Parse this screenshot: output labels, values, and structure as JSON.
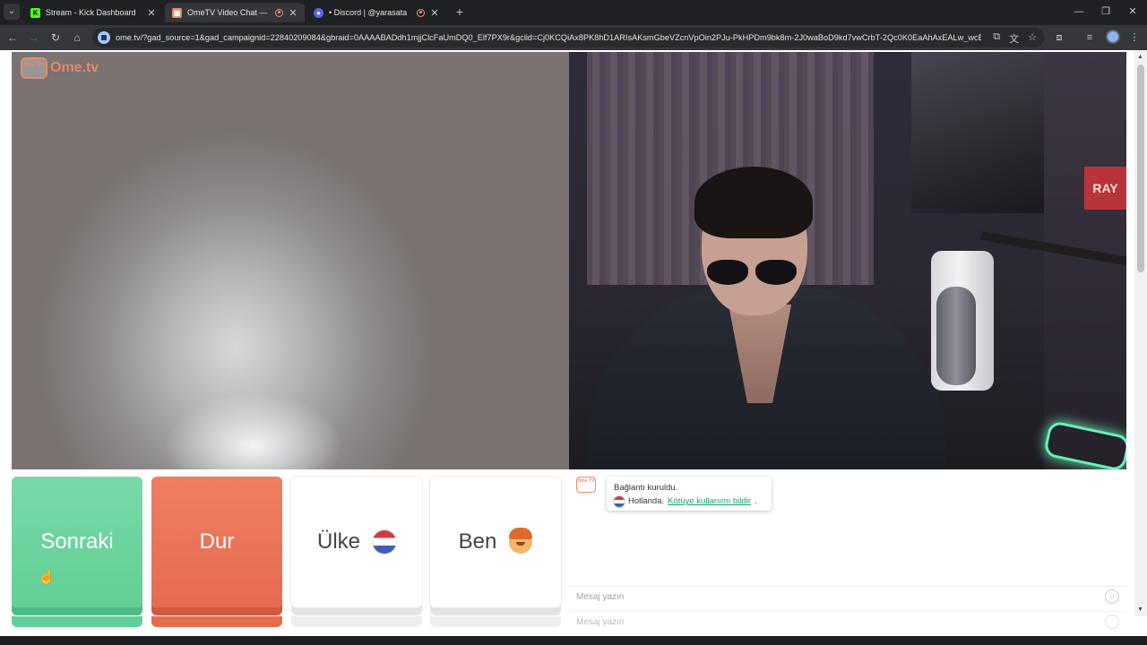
{
  "browser": {
    "tabs": [
      {
        "title": "Stream - Kick Dashboard",
        "active": false
      },
      {
        "title": "OmeTV Video Chat — Ome",
        "active": true
      },
      {
        "title": "• Discord | @yarasata",
        "active": false
      }
    ],
    "url": "ome.tv/?gad_source=1&gad_campaignid=22840209084&gbraid=0AAAABADdh1mjjClcFaUmDQ0_Elf7PX9r&gclid=Cj0KCQiAx8PK8hD1ARIsAKsmGbeVZcnVpOin2PJu-PkHPDm9bk8m-2J0waBoD9kd7vwCrbT-2Qc0K0EaAhAxEALw_wcB"
  },
  "site": {
    "logo_badge": "Ome TV",
    "logo_text": "Ome.tv"
  },
  "video_right": {
    "banner_text": "RAY"
  },
  "controls": {
    "next_label": "Sonraki",
    "stop_label": "Dur",
    "country_label": "Ülke",
    "me_label": "Ben"
  },
  "chat": {
    "avatar_text": "Ome TV",
    "connection_status": "Bağlantı kuruldu.",
    "partner_country": "Hollanda.",
    "report_link": "Kötüye kullanımı bildir",
    "report_suffix": ".",
    "input_placeholder": "Mesaj yazın",
    "ghost_placeholder": "Mesaj yazın"
  },
  "colors": {
    "next_button": "#62cf96",
    "stop_button": "#e66b4f",
    "brand": "#e58a6d",
    "report_link": "#1ea36b"
  }
}
